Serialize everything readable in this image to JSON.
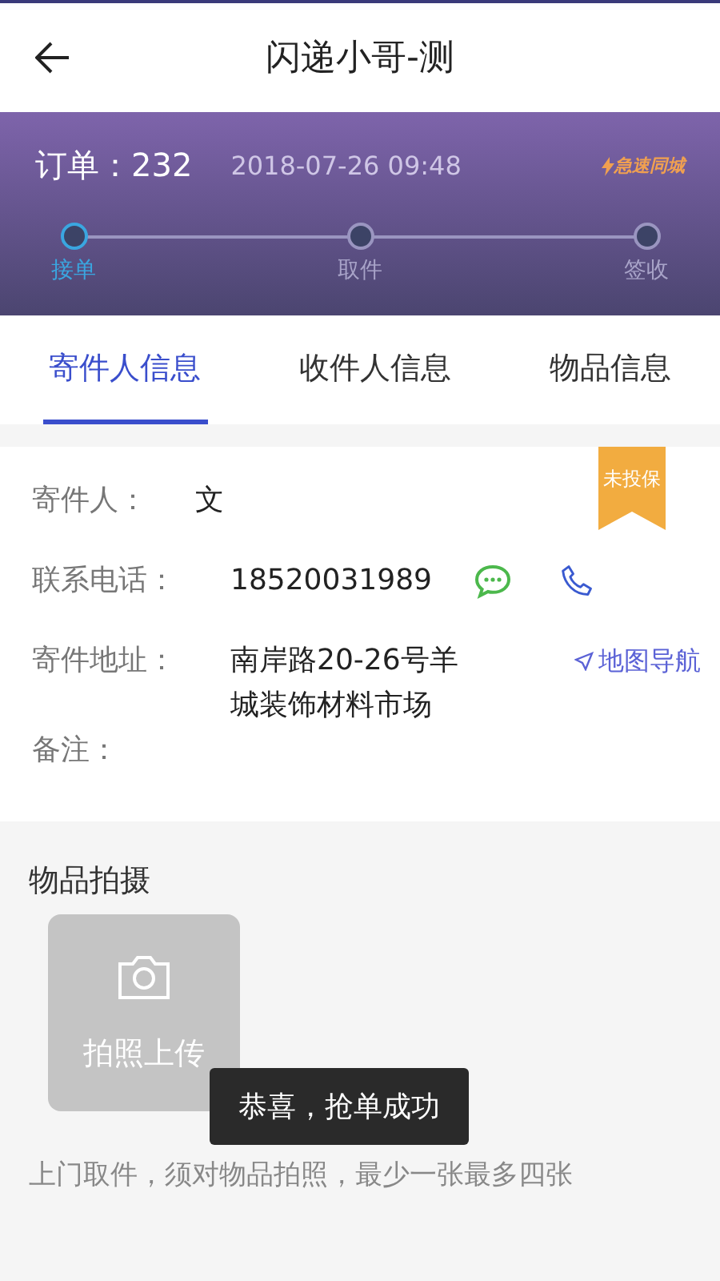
{
  "header": {
    "title": "闪递小哥-测"
  },
  "order": {
    "label": "订单：232",
    "time": "2018-07-26 09:48",
    "brand": "急速同城"
  },
  "steps": [
    {
      "label": "接单",
      "done": true
    },
    {
      "label": "取件",
      "done": false
    },
    {
      "label": "签收",
      "done": false
    }
  ],
  "tabs": [
    {
      "label": "寄件人信息",
      "selected": true
    },
    {
      "label": "收件人信息",
      "selected": false
    },
    {
      "label": "物品信息",
      "selected": false
    }
  ],
  "insurance_ribbon": "未投保",
  "fields": [
    {
      "kind": "text",
      "label": "寄件人：",
      "value": "文"
    },
    {
      "kind": "phone",
      "label": "联系电话：",
      "value": "18520031989"
    },
    {
      "kind": "address",
      "label": "寄件地址：",
      "value": "南岸路20-26号羊城装饰材料市场",
      "action": "地图导航"
    },
    {
      "kind": "text",
      "label": "备注："
    }
  ],
  "photo": {
    "title": "物品拍摄",
    "upload_label": "拍照上传",
    "hint": "上门取件，须对物品拍照，最少一张最多四张"
  },
  "toast": "恭喜，抢单成功"
}
